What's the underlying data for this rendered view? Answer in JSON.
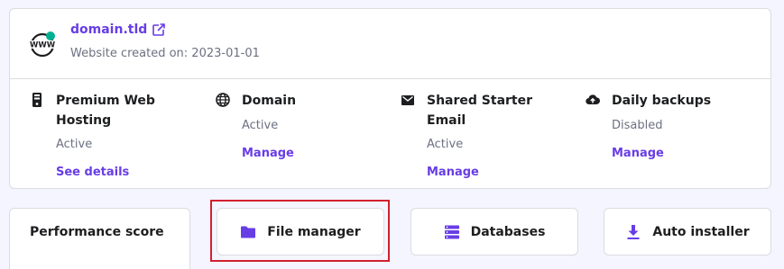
{
  "site": {
    "domain": "domain.tld",
    "created": "Website created on: 2023-01-01",
    "www_label": "WWW"
  },
  "services": [
    {
      "title": "Premium Web Hosting",
      "status": "Active",
      "link": "See details",
      "icon": "server-icon"
    },
    {
      "title": "Domain",
      "status": "Active",
      "link": "Manage",
      "icon": "globe-icon"
    },
    {
      "title": "Shared Starter Email",
      "status": "Active",
      "link": "Manage",
      "icon": "email-icon"
    },
    {
      "title": "Daily backups",
      "status": "Disabled",
      "link": "Manage",
      "icon": "cloud-upload-icon"
    }
  ],
  "performance": {
    "label": "Performance score"
  },
  "actions": {
    "file_manager": "File manager",
    "databases": "Databases",
    "auto_installer": "Auto installer"
  },
  "colors": {
    "accent": "#673de6",
    "online_dot": "#00b090",
    "highlight": "#d3202f",
    "background": "#f4f5ff"
  }
}
